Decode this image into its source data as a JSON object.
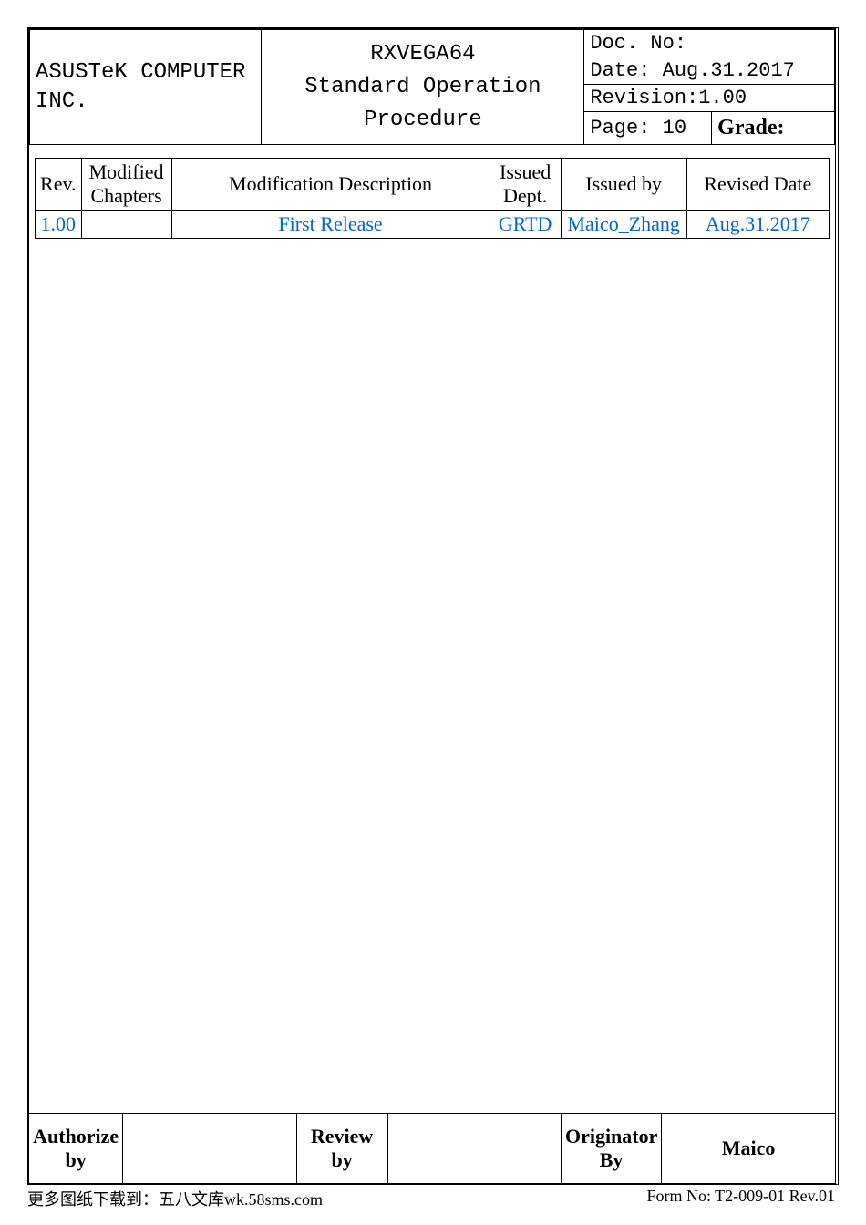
{
  "header": {
    "company": "ASUSTeK COMPUTER INC.",
    "title_line1": "RXVEGA64",
    "title_line2": "Standard Operation Procedure",
    "doc_no_label": "Doc. No:",
    "date": "Date: Aug.31.2017",
    "revision": "Revision:1.00",
    "page": "Page: 10",
    "grade_label": "Grade:"
  },
  "revision_table": {
    "headers": {
      "rev": "Rev.",
      "chapters": "Modified Chapters",
      "desc": "Modification Description",
      "dept": "Issued Dept.",
      "by": "Issued by",
      "date": "Revised Date"
    },
    "rows": [
      {
        "rev": "1.00",
        "chapters": "",
        "desc": "First Release",
        "dept": "GRTD",
        "by": "Maico_Zhang",
        "date": "Aug.31.2017"
      }
    ]
  },
  "footer": {
    "authorize_label": "Authorize by",
    "review_label": "Review by",
    "originator_label": "Originator By",
    "originator_name": "Maico"
  },
  "bottom": {
    "left": "更多图纸下载到：五八文库wk.58sms.com",
    "right": "Form No: T2-009-01 Rev.01"
  }
}
